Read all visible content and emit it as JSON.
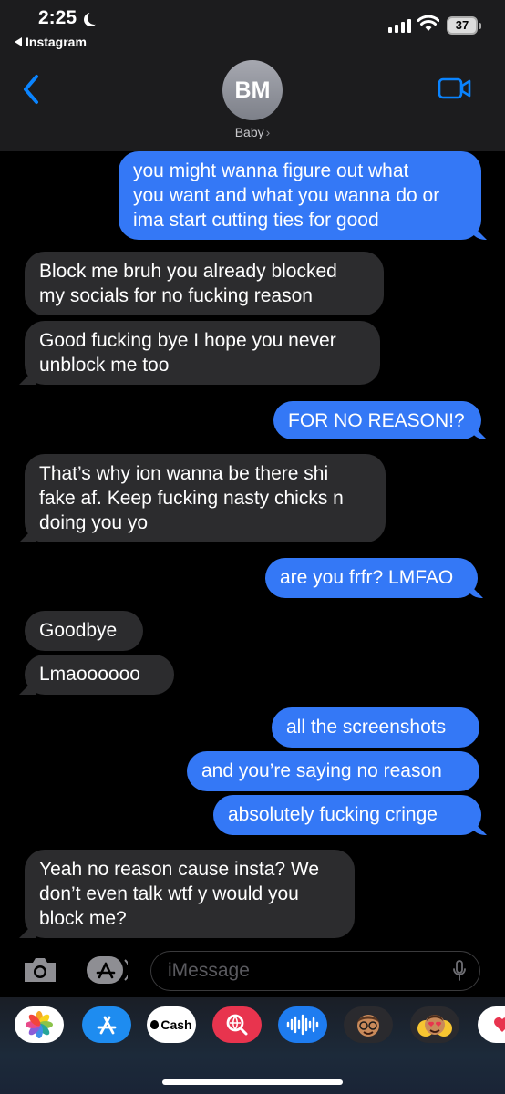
{
  "status": {
    "time": "2:25",
    "back_app": "Instagram",
    "battery": "37"
  },
  "contact": {
    "initials": "BM",
    "name": "Baby",
    "chevron": "›"
  },
  "messages": [
    {
      "side": "sent",
      "text": "you might wanna figure out what\nyou want and what you wanna do or\nima start cutting ties for good"
    },
    {
      "side": "recv",
      "text": "Block me bruh you already blocked\nmy socials for no fucking reason"
    },
    {
      "side": "recv",
      "text": "Good fucking bye I hope you never\nunblock me too"
    },
    {
      "side": "sent",
      "text": "FOR NO REASON!?"
    },
    {
      "side": "recv",
      "text": "That’s why ion wanna be there shi\nfake af. Keep fucking nasty chicks n\ndoing you yo"
    },
    {
      "side": "sent",
      "text": "are you frfr? LMFAO"
    },
    {
      "side": "recv",
      "text": "Goodbye"
    },
    {
      "side": "recv",
      "text": "Lmaoooooo"
    },
    {
      "side": "sent",
      "text": "all the screenshots"
    },
    {
      "side": "sent",
      "text": "and you’re saying no reason"
    },
    {
      "side": "sent",
      "text": "absolutely fucking cringe"
    },
    {
      "side": "recv",
      "text": "Yeah no reason cause insta? We\ndon’t even talk wtf y would you\nblock me?"
    }
  ],
  "input": {
    "placeholder": "iMessage"
  },
  "drawer": {
    "apps": [
      {
        "name": "photos-app-icon"
      },
      {
        "name": "app-store-app-icon"
      },
      {
        "name": "apple-cash-app-icon",
        "label": "Cash"
      },
      {
        "name": "images-search-app-icon"
      },
      {
        "name": "audio-message-app-icon"
      },
      {
        "name": "memoji-app-icon"
      },
      {
        "name": "memoji-stickers-app-icon"
      },
      {
        "name": "digital-touch-app-icon"
      }
    ]
  },
  "colors": {
    "sent": "#3478f6",
    "received": "#2c2c2e",
    "accent": "#0a84ff",
    "header": "#1c1c1e"
  }
}
